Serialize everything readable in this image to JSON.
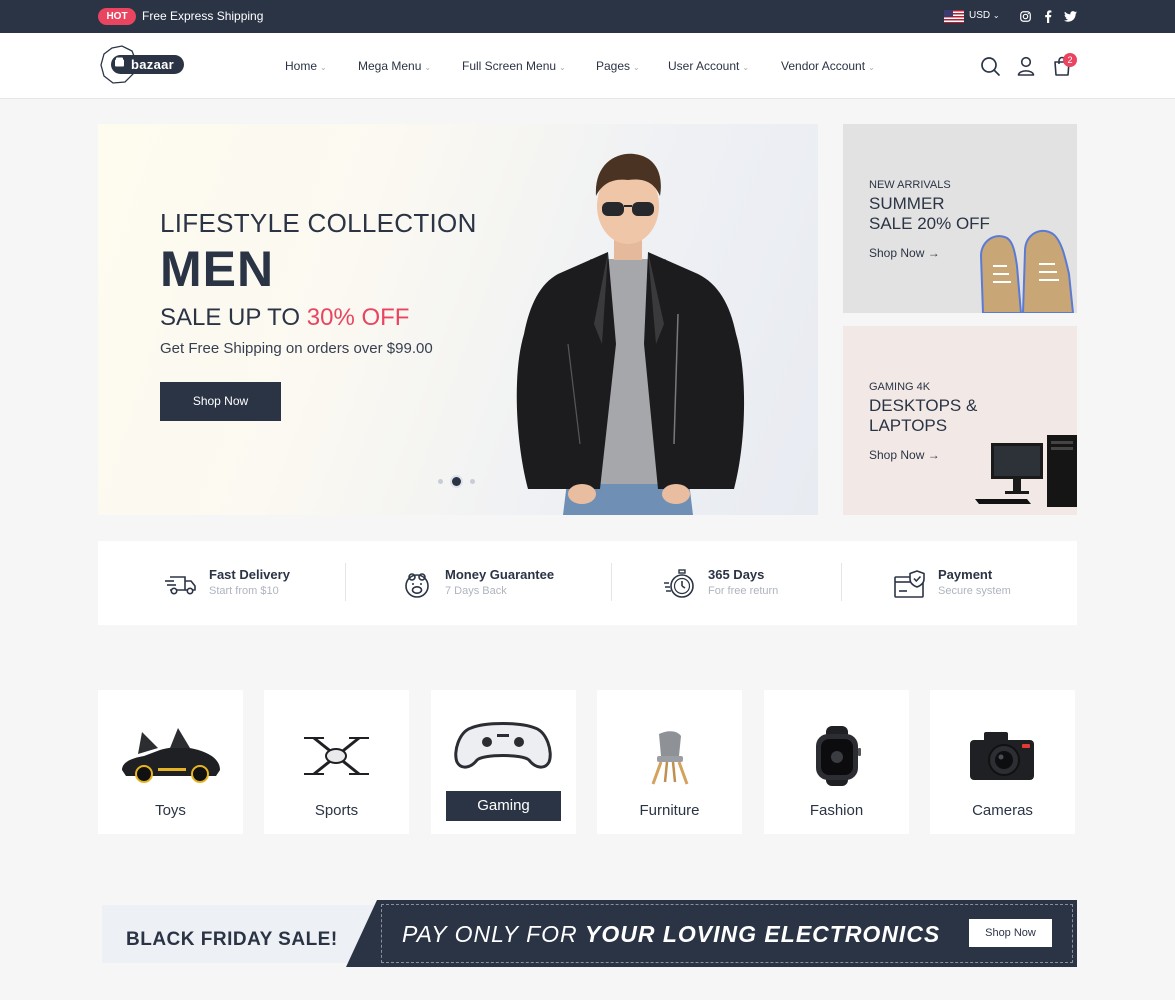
{
  "topbar": {
    "badge": "HOT",
    "text": "Free Express Shipping",
    "currency": "USD",
    "social_icons": [
      "instagram-icon",
      "facebook-icon",
      "twitter-icon"
    ]
  },
  "header": {
    "logo_text": "bazaar",
    "nav": [
      {
        "label": "Home"
      },
      {
        "label": "Mega Menu"
      },
      {
        "label": "Full Screen Menu"
      },
      {
        "label": "Pages"
      },
      {
        "label": "User Account"
      },
      {
        "label": "Vendor Account"
      }
    ],
    "cart_count": "2",
    "icons": [
      "search-icon",
      "user-icon",
      "cart-icon"
    ]
  },
  "hero": {
    "subtitle": "LIFESTYLE COLLECTION",
    "title": "MEN",
    "sale_prefix": "SALE UP TO ",
    "sale_accent": "30% OFF",
    "note": "Get Free Shipping on orders over $99.00",
    "button": "Shop Now",
    "slide_count": 3,
    "active_slide": 2
  },
  "promos": [
    {
      "kicker": "NEW ARRIVALS",
      "title_line1": "SUMMER",
      "title_line2": "SALE 20% OFF",
      "link": "Shop Now"
    },
    {
      "kicker": "GAMING 4K",
      "title_line1": "DESKTOPS &",
      "title_line2": "LAPTOPS",
      "link": "Shop Now"
    }
  ],
  "services": [
    {
      "title": "Fast Delivery",
      "subtitle": "Start from $10",
      "icon": "truck-icon"
    },
    {
      "title": "Money Guarantee",
      "subtitle": "7 Days Back",
      "icon": "piggy-bank-icon"
    },
    {
      "title": "365 Days",
      "subtitle": "For free return",
      "icon": "stopwatch-icon"
    },
    {
      "title": "Payment",
      "subtitle": "Secure system",
      "icon": "secure-payment-icon"
    }
  ],
  "categories": [
    {
      "label": "Toys",
      "icon": "toy-car-icon"
    },
    {
      "label": "Sports",
      "icon": "drone-icon"
    },
    {
      "label": "Gaming",
      "icon": "gamepad-icon",
      "active": true
    },
    {
      "label": "Furniture",
      "icon": "chair-icon"
    },
    {
      "label": "Fashion",
      "icon": "watch-icon"
    },
    {
      "label": "Cameras",
      "icon": "camera-icon"
    }
  ],
  "banner": {
    "left": "BLACK FRIDAY SALE!",
    "right_prefix": "PAY ONLY FOR ",
    "right_bold": "YOUR LOVING ELECTRONICS",
    "button": "Shop Now"
  },
  "colors": {
    "primary": "#2b3445",
    "accent": "#e94560",
    "background": "#f6f6f6"
  }
}
